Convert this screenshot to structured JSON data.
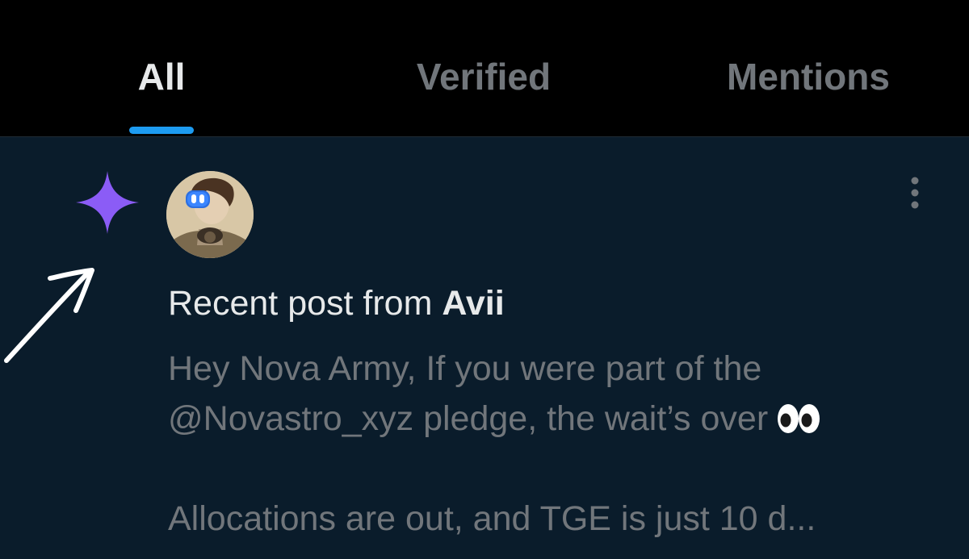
{
  "tabs": [
    {
      "label": "All",
      "active": true
    },
    {
      "label": "Verified",
      "active": false
    },
    {
      "label": "Mentions",
      "active": false
    }
  ],
  "notification": {
    "type_icon": "sparkle-icon",
    "avatar": "user-avatar",
    "title_prefix": "Recent post from ",
    "author": "Avii",
    "body_line_1": "Hey Nova Army, If you were part of the",
    "body_line_2": "@Novastro_xyz pledge, the wait’s over",
    "body_line_2_emoji": "eyes-emoji",
    "body_line_3": "Allocations are out, and TGE is just 10 d..."
  },
  "colors": {
    "tab_bar_bg": "#000000",
    "notification_bg": "#0a1c2b",
    "active_tab_text": "#e7e9ea",
    "inactive_tab_text": "#71767b",
    "tab_indicator": "#1d9bf0",
    "sparkle": "#8b5cf6",
    "annotation_arrow": "#ffffff"
  }
}
